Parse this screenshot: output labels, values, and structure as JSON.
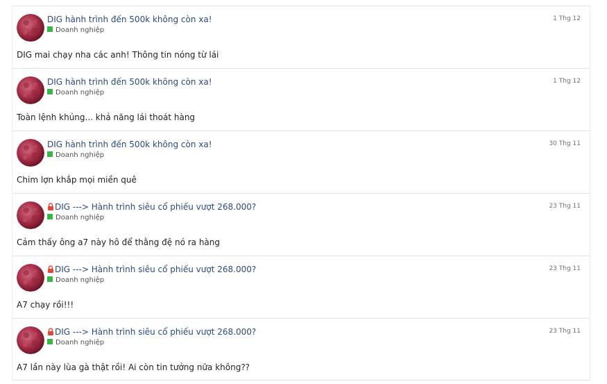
{
  "feed": {
    "posts": [
      {
        "locked": false,
        "title": "DIG hành trình đến 500k không còn xa!",
        "category": "Doanh nghiệp",
        "date": "1 Thg 12",
        "body": "DIG mai chạy nha các anh! Thông tin nóng từ lái"
      },
      {
        "locked": false,
        "title": "DIG hành trình đến 500k không còn xa!",
        "category": "Doanh nghiệp",
        "date": "1 Thg 12",
        "body": "Toàn lệnh khủng... khả năng lái thoát hàng"
      },
      {
        "locked": false,
        "title": "DIG hành trình đến 500k không còn xa!",
        "category": "Doanh nghiệp",
        "date": "30 Thg 11",
        "body": "Chim lợn khắp mọi miền quê"
      },
      {
        "locked": true,
        "title": "DIG ---> Hành trình siêu cổ phiếu vượt 268.000?",
        "category": "Doanh nghiệp",
        "date": "23 Thg 11",
        "body": "Cảm thấy ông a7 này hô để thằng đệ nó ra hàng"
      },
      {
        "locked": true,
        "title": "DIG ---> Hành trình siêu cổ phiếu vượt 268.000?",
        "category": "Doanh nghiệp",
        "date": "23 Thg 11",
        "body": "A7 chạy rồi!!!"
      },
      {
        "locked": true,
        "title": "DIG ---> Hành trình siêu cổ phiếu vượt 268.000?",
        "category": "Doanh nghiệp",
        "date": "23 Thg 11",
        "body": "A7 lần này lùa gà thật rồi! Ai còn tin tưởng nữa không??"
      }
    ]
  },
  "icons": {
    "avatar": "red-moon-avatar",
    "lock": "lock-icon",
    "category": "green-square-icon"
  },
  "colors": {
    "title_link": "#2b4a7e",
    "category_marker": "#3bb54a",
    "lock": "#e8443a",
    "body_text": "#222222"
  }
}
